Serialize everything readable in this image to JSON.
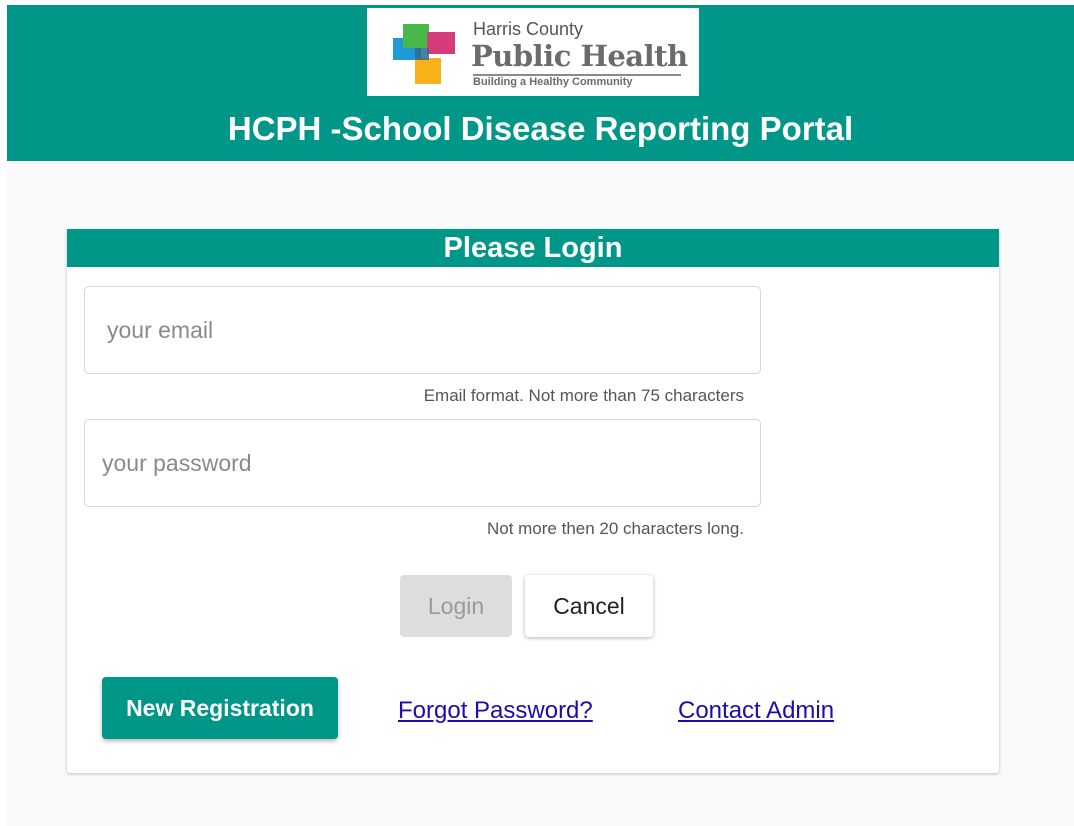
{
  "header": {
    "logo": {
      "line1": "Harris County",
      "line2": "Public Health",
      "line3": "Building a Healthy Community"
    },
    "title": "HCPH -School Disease Reporting Portal"
  },
  "login": {
    "heading": "Please Login",
    "email": {
      "placeholder": "your email",
      "value": "",
      "hint": "Email format. Not more than 75 characters"
    },
    "password": {
      "placeholder": "your password",
      "value": "",
      "hint": "Not more then 20 characters long."
    },
    "login_label": "Login",
    "cancel_label": "Cancel",
    "register_label": "New Registration",
    "forgot_label": "Forgot Password?",
    "contact_label": "Contact Admin"
  },
  "colors": {
    "brand": "#009688",
    "link": "#1a0dab",
    "disabled_button": "#dddddd",
    "logo_pink": "#d63c7c",
    "logo_green": "#49b84a",
    "logo_blue": "#1e9bd7",
    "logo_yellow": "#f7b21a"
  },
  "icons": {
    "logo": "harris-county-logo-mark"
  }
}
